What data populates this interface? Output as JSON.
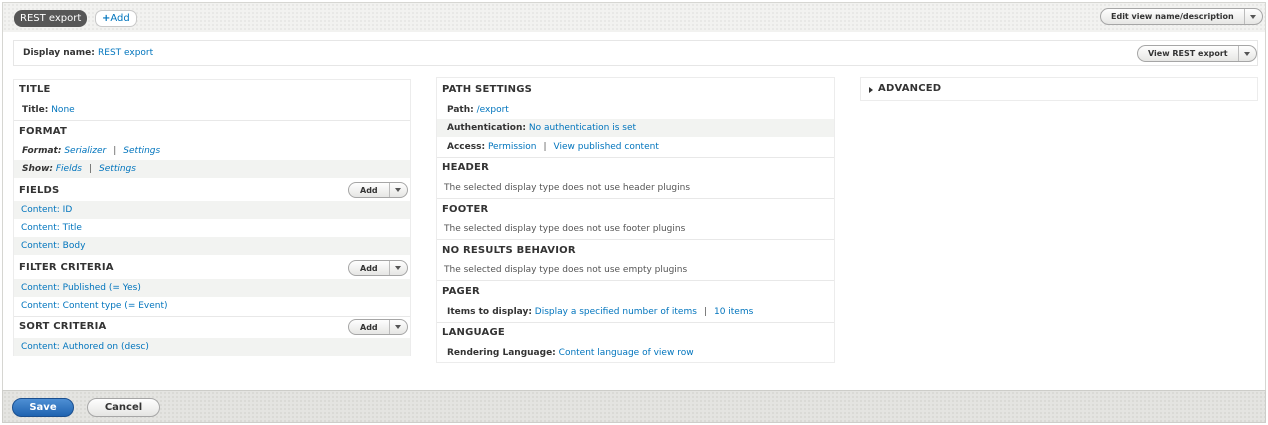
{
  "tabs": {
    "display_tab": "REST export",
    "add_tab": "Add",
    "add_icon": "plus-icon",
    "edit_view_button": "Edit view name/description"
  },
  "display_name": {
    "label": "Display name:",
    "value": "REST export",
    "view_button": "View REST export"
  },
  "column1": {
    "title": {
      "heading": "TITLE",
      "label": "Title:",
      "value": "None"
    },
    "format": {
      "heading": "FORMAT",
      "format_label": "Format:",
      "format_value": "Serializer",
      "format_settings": "Settings",
      "show_label": "Show:",
      "show_value": "Fields",
      "show_settings": "Settings"
    },
    "fields": {
      "heading": "FIELDS",
      "add_label": "Add",
      "items": [
        "Content: ID",
        "Content: Title",
        "Content: Body"
      ]
    },
    "filter_criteria": {
      "heading": "FILTER CRITERIA",
      "add_label": "Add",
      "items": [
        "Content: Published (= Yes)",
        "Content: Content type (= Event)"
      ]
    },
    "sort_criteria": {
      "heading": "SORT CRITERIA",
      "add_label": "Add",
      "items": [
        "Content: Authored on (desc)"
      ]
    }
  },
  "column2": {
    "path_settings": {
      "heading": "PATH SETTINGS",
      "path_label": "Path:",
      "path_value": "/export",
      "auth_label": "Authentication:",
      "auth_value": "No authentication is set",
      "access_label": "Access:",
      "access_value": "Permission",
      "access_link2": "View published content"
    },
    "header": {
      "heading": "HEADER",
      "note": "The selected display type does not use header plugins"
    },
    "footer": {
      "heading": "FOOTER",
      "note": "The selected display type does not use footer plugins"
    },
    "no_results": {
      "heading": "NO RESULTS BEHAVIOR",
      "note": "The selected display type does not use empty plugins"
    },
    "pager": {
      "heading": "PAGER",
      "label": "Items to display:",
      "value": "Display a specified number of items",
      "count": "10 items"
    },
    "language": {
      "heading": "LANGUAGE",
      "label": "Rendering Language:",
      "value": "Content language of view row"
    }
  },
  "column3": {
    "advanced": "ADVANCED"
  },
  "footer_buttons": {
    "save": "Save",
    "cancel": "Cancel"
  },
  "colors": {
    "link": "#0074bd",
    "save_button": "#2f74c0",
    "active_tab": "#575757"
  }
}
